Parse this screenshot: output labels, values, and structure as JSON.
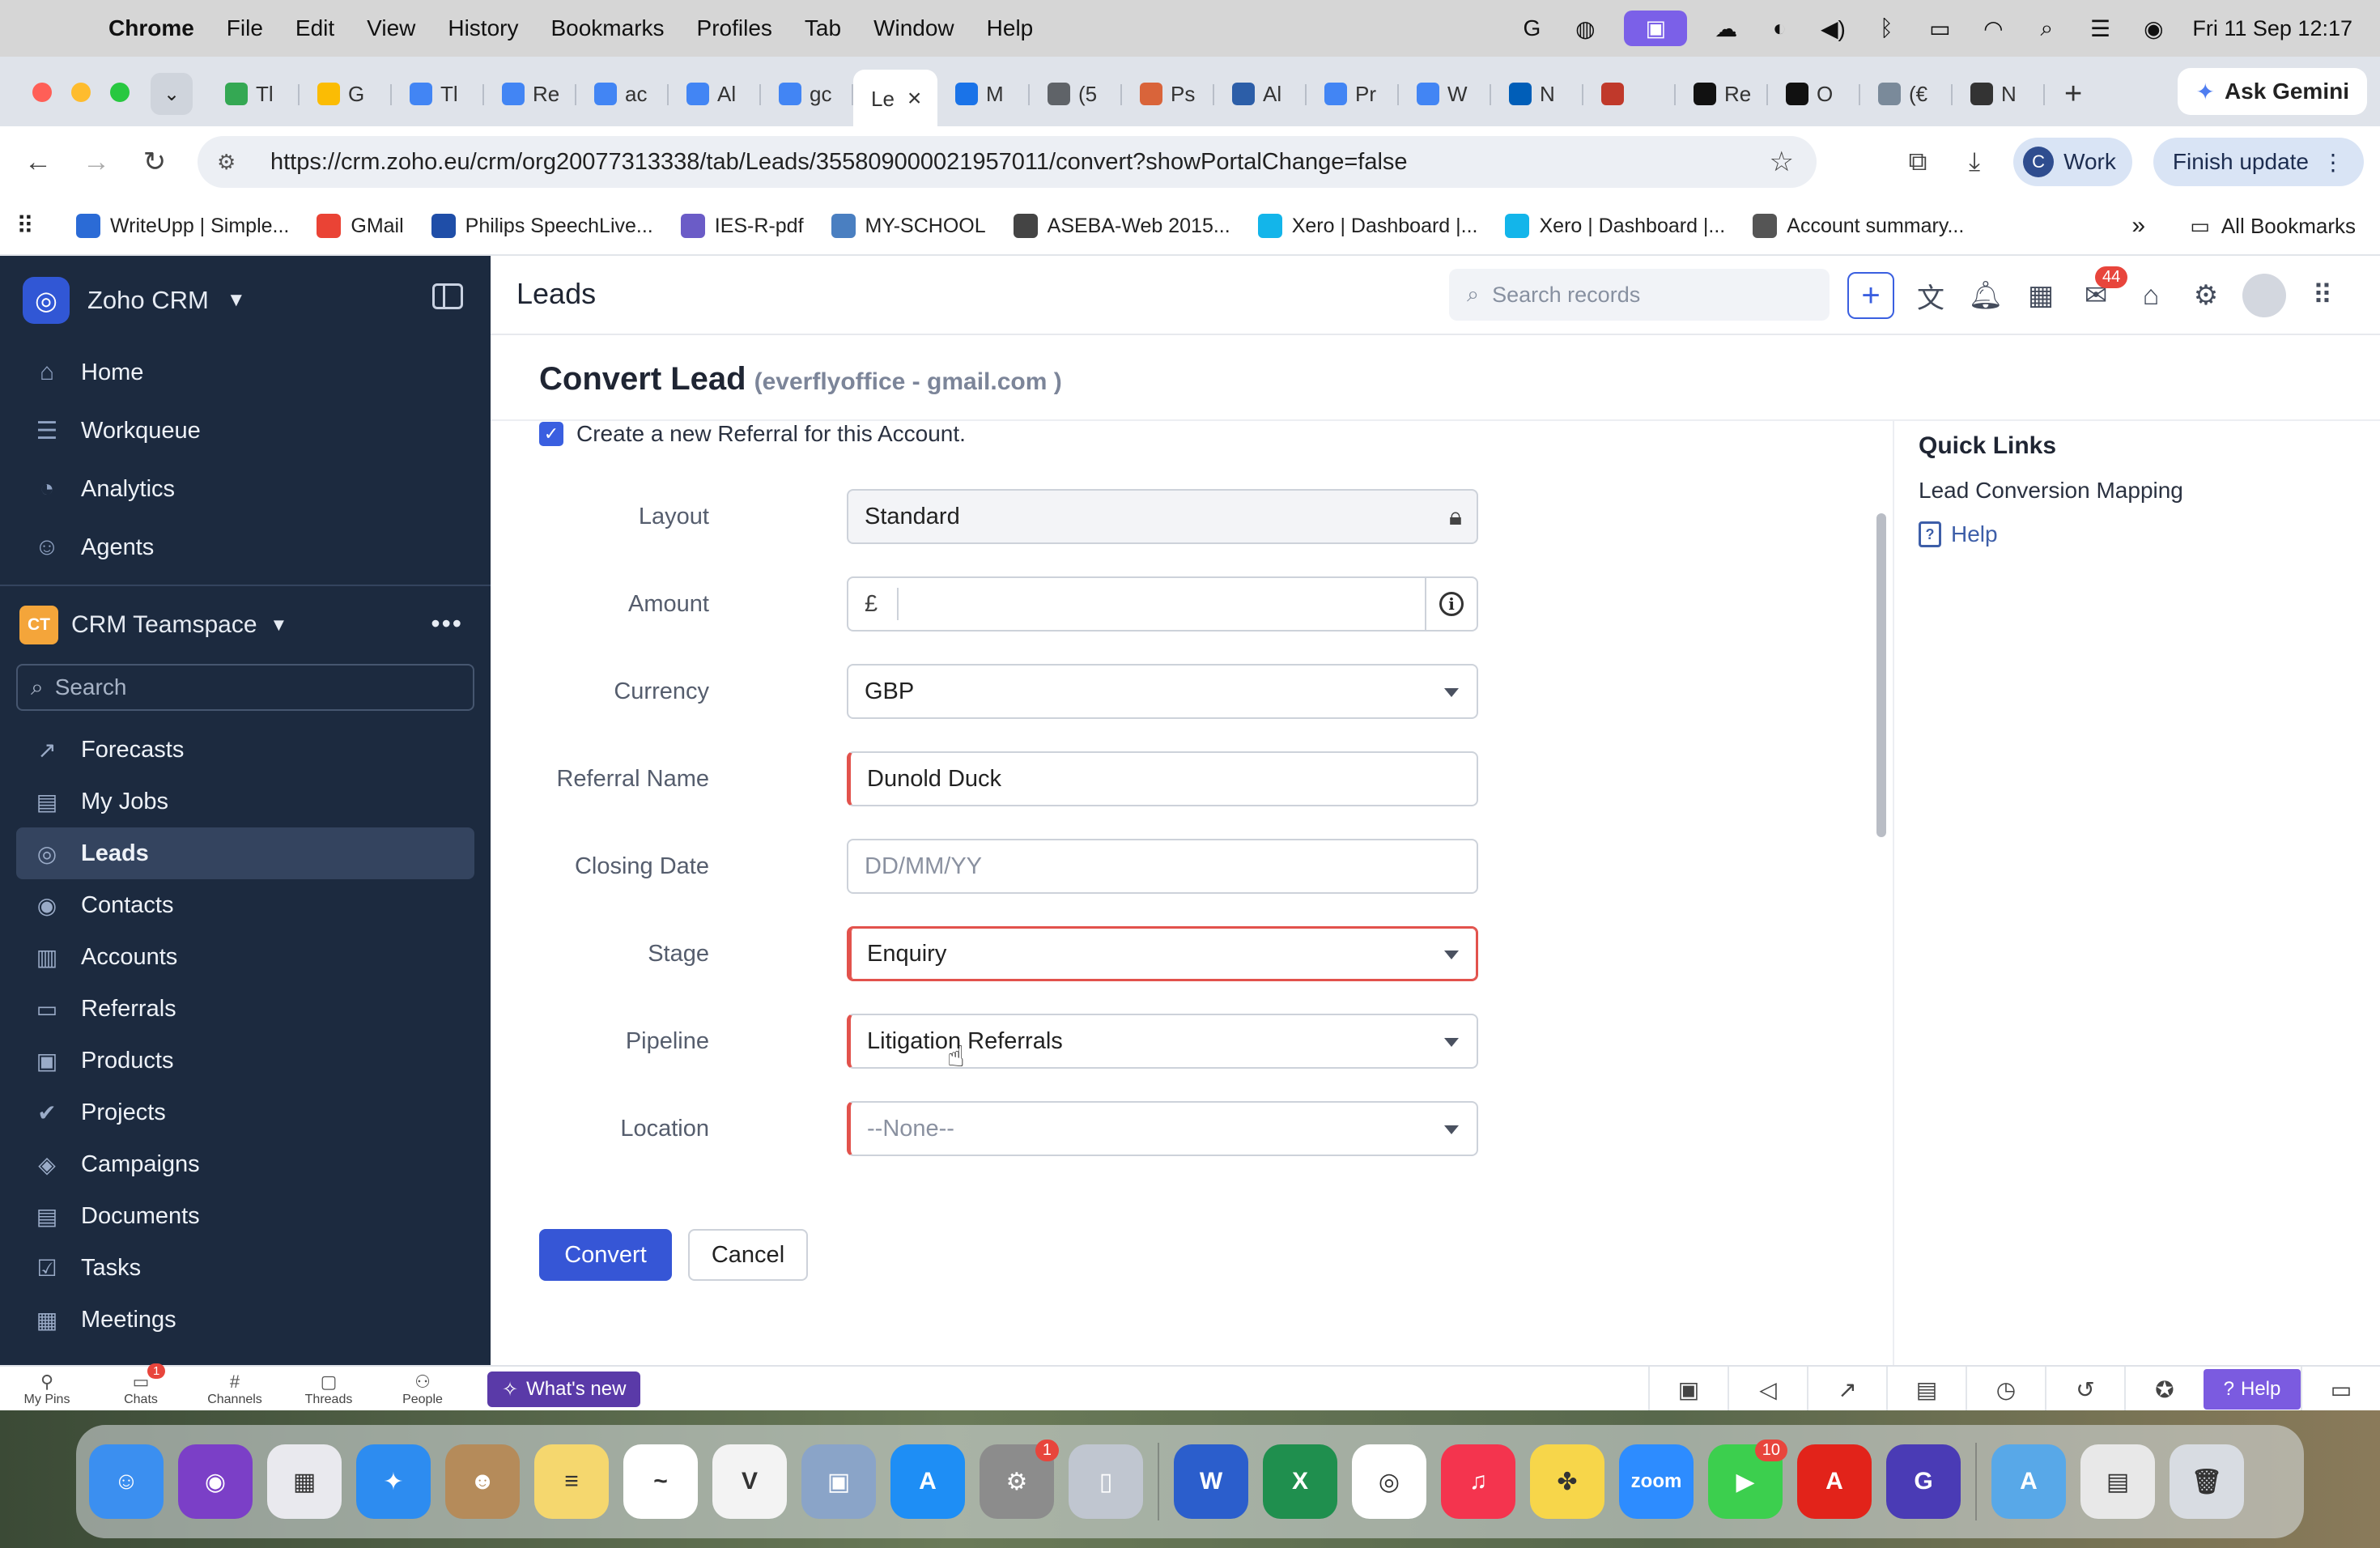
{
  "menubar": {
    "app": "Chrome",
    "items": [
      "File",
      "Edit",
      "View",
      "History",
      "Bookmarks",
      "Profiles",
      "Tab",
      "Window",
      "Help"
    ],
    "clock": "Fri 11 Sep  12:17"
  },
  "tabs": [
    {
      "label": "Tl",
      "color": "#34a853"
    },
    {
      "label": "G",
      "color": "#fbbc04"
    },
    {
      "label": "Tl",
      "color": "#4285f4"
    },
    {
      "label": "Re",
      "color": "#4285f4"
    },
    {
      "label": "ac",
      "color": "#4285f4"
    },
    {
      "label": "Al",
      "color": "#4285f4"
    },
    {
      "label": "gc",
      "color": "#4285f4"
    },
    {
      "label": "Le",
      "color": "#ffffff",
      "active": true
    },
    {
      "label": "M",
      "color": "#1a73e8"
    },
    {
      "label": "(5",
      "color": "#5f6368"
    },
    {
      "label": "Ps",
      "color": "#d9643a"
    },
    {
      "label": "Al",
      "color": "#2c5ea8"
    },
    {
      "label": "Pr",
      "color": "#4285f4"
    },
    {
      "label": "W",
      "color": "#4285f4"
    },
    {
      "label": "N",
      "color": "#005eb8"
    },
    {
      "label": "",
      "color": "#c0392b"
    },
    {
      "label": "Re",
      "color": "#111111"
    },
    {
      "label": "O",
      "color": "#111111"
    },
    {
      "label": "(€",
      "color": "#7a8a9a"
    },
    {
      "label": "N",
      "color": "#333333"
    }
  ],
  "ask_gemini": "Ask Gemini",
  "address": {
    "url": "https://crm.zoho.eu/crm/org20077313338/tab/Leads/355809000021957011/convert?showPortalChange=false"
  },
  "profile": {
    "initial": "C",
    "label": "Work"
  },
  "finish_update": "Finish update",
  "bookmarks": [
    {
      "label": "WriteUpp | Simple...",
      "color": "#2b6bd6"
    },
    {
      "label": "GMail",
      "color": "#ea4335"
    },
    {
      "label": "Philips SpeechLive...",
      "color": "#1f4ea8"
    },
    {
      "label": "IES-R-pdf",
      "color": "#6b5cc7"
    },
    {
      "label": "MY-SCHOOL",
      "color": "#4a7fc1"
    },
    {
      "label": "ASEBA-Web 2015...",
      "color": "#444444"
    },
    {
      "label": "Xero | Dashboard |...",
      "color": "#13b5ea"
    },
    {
      "label": "Xero | Dashboard |...",
      "color": "#13b5ea"
    },
    {
      "label": "Account summary...",
      "color": "#555555"
    }
  ],
  "all_bookmarks": "All Bookmarks",
  "sidebar": {
    "brand": "Zoho CRM",
    "main_nav": [
      {
        "label": "Home",
        "icon": "home-icon",
        "glyph": "⌂"
      },
      {
        "label": "Workqueue",
        "icon": "workqueue-icon",
        "glyph": "☰"
      },
      {
        "label": "Analytics",
        "icon": "analytics-icon",
        "glyph": "◔"
      },
      {
        "label": "Agents",
        "icon": "agents-icon",
        "glyph": "☺"
      }
    ],
    "teamspace_badge": "CT",
    "teamspace": "CRM Teamspace",
    "search_placeholder": "Search",
    "modules": [
      {
        "label": "Forecasts",
        "icon": "forecasts-icon",
        "glyph": "↗"
      },
      {
        "label": "My Jobs",
        "icon": "my-jobs-icon",
        "glyph": "▤"
      },
      {
        "label": "Leads",
        "icon": "leads-icon",
        "glyph": "◎",
        "active": true
      },
      {
        "label": "Contacts",
        "icon": "contacts-icon",
        "glyph": "◉"
      },
      {
        "label": "Accounts",
        "icon": "accounts-icon",
        "glyph": "▥"
      },
      {
        "label": "Referrals",
        "icon": "referrals-icon",
        "glyph": "▭"
      },
      {
        "label": "Products",
        "icon": "products-icon",
        "glyph": "▣"
      },
      {
        "label": "Projects",
        "icon": "projects-icon",
        "glyph": "✔"
      },
      {
        "label": "Campaigns",
        "icon": "campaigns-icon",
        "glyph": "◈"
      },
      {
        "label": "Documents",
        "icon": "documents-icon",
        "glyph": "▤"
      },
      {
        "label": "Tasks",
        "icon": "tasks-icon",
        "glyph": "☑"
      },
      {
        "label": "Meetings",
        "icon": "meetings-icon",
        "glyph": "▦"
      }
    ]
  },
  "header": {
    "title": "Leads",
    "search_placeholder": "Search records",
    "notification_badge": "44"
  },
  "convert": {
    "title": "Convert Lead",
    "subtitle": "(everflyoffice - gmail.com )",
    "checkbox_label": "Create a new Referral for this Account.",
    "fields": {
      "layout": {
        "label": "Layout",
        "value": "Standard"
      },
      "amount": {
        "label": "Amount",
        "currency_symbol": "£",
        "value": ""
      },
      "currency": {
        "label": "Currency",
        "value": "GBP"
      },
      "referral_name": {
        "label": "Referral Name",
        "value": "Dunold Duck"
      },
      "closing_date": {
        "label": "Closing Date",
        "placeholder": "DD/MM/YY"
      },
      "stage": {
        "label": "Stage",
        "value": "Enquiry"
      },
      "pipeline": {
        "label": "Pipeline",
        "value": "Litigation Referrals"
      },
      "location": {
        "label": "Location",
        "value": "--None--"
      }
    },
    "convert_button": "Convert",
    "cancel_button": "Cancel"
  },
  "quick_links": {
    "title": "Quick Links",
    "mapping": "Lead Conversion Mapping",
    "help": "Help"
  },
  "bottombar": {
    "items": [
      {
        "label": "My Pins",
        "icon": "pin-icon",
        "glyph": "⚲"
      },
      {
        "label": "Chats",
        "icon": "chats-icon",
        "glyph": "▭",
        "badge": "1"
      },
      {
        "label": "Channels",
        "icon": "channels-icon",
        "glyph": "#"
      },
      {
        "label": "Threads",
        "icon": "threads-icon",
        "glyph": "▢"
      },
      {
        "label": "People",
        "icon": "people-icon",
        "glyph": "⚇"
      }
    ],
    "whats_new": "What's new",
    "help": "Help"
  },
  "dock": [
    {
      "name": "finder",
      "color": "#3b8ff0",
      "glyph": "☺"
    },
    {
      "name": "siri",
      "color": "#7b3fc7",
      "glyph": "◉"
    },
    {
      "name": "launchpad",
      "color": "#e9e9ee",
      "glyph": "▦"
    },
    {
      "name": "safari",
      "color": "#2d8cf0",
      "glyph": "✦"
    },
    {
      "name": "contacts",
      "color": "#b58b5a",
      "glyph": "☻"
    },
    {
      "name": "notes",
      "color": "#f5d76e",
      "glyph": "≡"
    },
    {
      "name": "freeform",
      "color": "#ffffff",
      "glyph": "~"
    },
    {
      "name": "vectorworks",
      "color": "#f3f3f3",
      "glyph": "V"
    },
    {
      "name": "preview",
      "color": "#8aa4c8",
      "glyph": "▣"
    },
    {
      "name": "app-store",
      "color": "#1e8ef5",
      "glyph": "A"
    },
    {
      "name": "system-settings",
      "color": "#8c8c8c",
      "glyph": "⚙",
      "badge": "1"
    },
    {
      "name": "iphone-mirroring",
      "color": "#c0c6d0",
      "glyph": "▯"
    },
    {
      "name": "word",
      "color": "#2b5ecc",
      "glyph": "W"
    },
    {
      "name": "excel",
      "color": "#1f8f4e",
      "glyph": "X"
    },
    {
      "name": "chrome",
      "color": "#ffffff",
      "glyph": "◎"
    },
    {
      "name": "music",
      "color": "#f4344e",
      "glyph": "♫"
    },
    {
      "name": "clover",
      "color": "#f7d64a",
      "glyph": "✤"
    },
    {
      "name": "zoom",
      "color": "#2d8cff",
      "glyph": "zoom"
    },
    {
      "name": "facetime",
      "color": "#3ccf4e",
      "glyph": "▶",
      "badge": "10"
    },
    {
      "name": "acrobat",
      "color": "#e2231a",
      "glyph": "A"
    },
    {
      "name": "grammarly",
      "color": "#4a3bb5",
      "glyph": "G"
    },
    {
      "name": "applications-folder",
      "color": "#58a8e8",
      "glyph": "A"
    },
    {
      "name": "downloads-stack",
      "color": "#e8e8e8",
      "glyph": "▤"
    },
    {
      "name": "trash",
      "color": "#d8dce2",
      "glyph": "🗑"
    }
  ]
}
